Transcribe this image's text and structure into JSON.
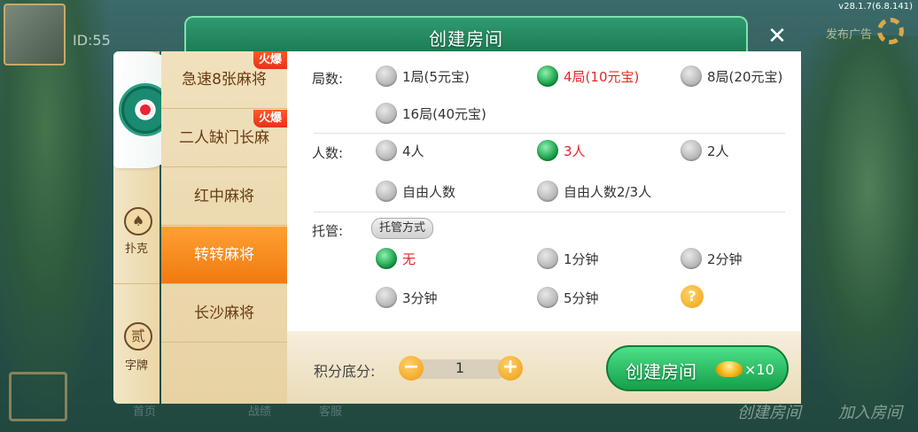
{
  "background": {
    "id_text": "ID:55",
    "version": "v28.1.7(6.8.141)",
    "broadcast": "发布广告",
    "bottom_create": "创建房间",
    "bottom_join": "加入房间",
    "bottom_items": [
      "首页",
      "战绩",
      "客服"
    ]
  },
  "dialog": {
    "title": "创建房间",
    "close": "✕"
  },
  "sidebar": {
    "tabs": [
      {
        "label": "扑克",
        "icon": "♠"
      },
      {
        "label": "字牌",
        "icon": "贰"
      }
    ]
  },
  "games": [
    {
      "name": "急速8张麻将",
      "hot": "火爆"
    },
    {
      "name": "二人缺门长麻",
      "hot": "火爆"
    },
    {
      "name": "红中麻将"
    },
    {
      "name": "转转麻将",
      "selected": true
    },
    {
      "name": "长沙麻将"
    }
  ],
  "settings": {
    "rounds": {
      "label": "局数:",
      "options": [
        "1局(5元宝)",
        "4局(10元宝)",
        "8局(20元宝)",
        "16局(40元宝)"
      ],
      "selected": 1
    },
    "players": {
      "label": "人数:",
      "options": [
        "4人",
        "3人",
        "2人",
        "自由人数",
        "自由人数2/3人"
      ],
      "selected": 1
    },
    "auto": {
      "label": "托管:",
      "mode_button": "托管方式",
      "options": [
        "无",
        "1分钟",
        "2分钟",
        "3分钟",
        "5分钟"
      ],
      "selected": 0,
      "help": "?"
    }
  },
  "footer": {
    "score_label": "积分底分:",
    "score_value": "1",
    "minus": "−",
    "plus": "+",
    "create_label": "创建房间",
    "create_cost": "×10"
  },
  "colors": {
    "header_green": "#1a7a52",
    "selected_orange": "#f07a10",
    "selected_text_red": "#e02828",
    "button_green": "#15a04a"
  }
}
